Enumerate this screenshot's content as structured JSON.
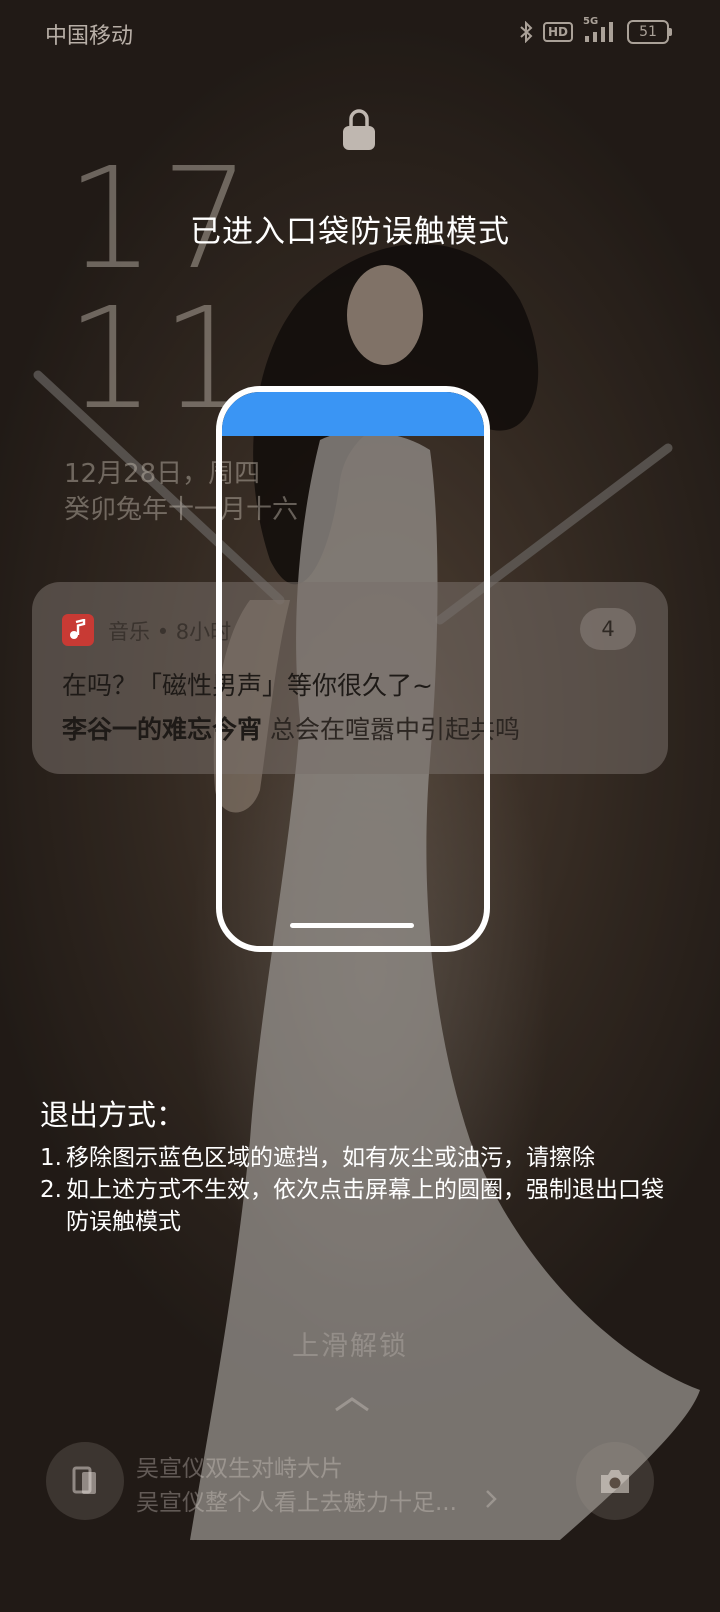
{
  "status_bar": {
    "carrier": "中国移动",
    "network": "5G",
    "hd": "HD",
    "battery": "51"
  },
  "clock": {
    "hour": "17",
    "minute": "11"
  },
  "date": {
    "gregorian": "12月28日，周四",
    "lunar": "癸卯兔年十一月十六"
  },
  "notification": {
    "app_name": "音乐",
    "time": "8小时",
    "count": "4",
    "title": "在吗？「磁性男声」等你很久了~",
    "body_bold": "李谷一的难忘今宵",
    "body_rest": " 总会在喧嚣中引起共鸣"
  },
  "pocket_mode": {
    "title": "已进入口袋防误触模式",
    "exit_heading": "退出方式：",
    "steps": [
      {
        "num": "1.",
        "text": "移除图示蓝色区域的遮挡，如有灰尘或油污，请擦除"
      },
      {
        "num": "2.",
        "text": "如上述方式不生效，依次点击屏幕上的圆圈，强制退出口袋防误触模式"
      }
    ],
    "highlight_color": "#3a95f4"
  },
  "lockscreen": {
    "swipe_hint": "上滑解锁",
    "wallpaper_title": "吴宣仪双生对峙大片",
    "wallpaper_desc": "吴宣仪整个人看上去魅力十足..."
  },
  "icons": {
    "bluetooth": "bluetooth-icon",
    "signal": "signal-icon",
    "lock": "lock-icon",
    "music": "music-app-icon",
    "chevron_up": "chevron-up-icon",
    "magazine": "magazine-icon",
    "camera": "camera-icon"
  }
}
